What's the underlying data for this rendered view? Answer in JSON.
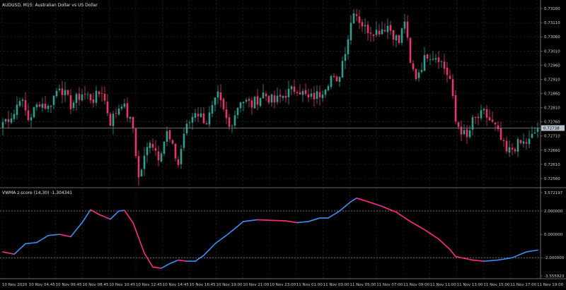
{
  "main_panel": {
    "title": "AUDUSD, M15:  Australian Dollar vs US Dollar",
    "price_ticks": [
      "0.73160",
      "0.73110",
      "0.73060",
      "0.73010",
      "0.72960",
      "0.72910",
      "0.72860",
      "0.72810",
      "0.72760",
      "0.72710",
      "0.72660",
      "0.72610",
      "0.72560"
    ],
    "current_price": "0.72738",
    "colors": {
      "bull": "#2e9e8e",
      "bear": "#e8356a",
      "grid": "#233040",
      "current_line": "#8a8a8a",
      "pricebox": "#b7c2cc"
    }
  },
  "indicator_panel": {
    "title": "VWMA z-score (14,30) -1.304341",
    "ticks": [
      "3.572197",
      "2.000000",
      "0.000000",
      "-2.000000",
      "-3.555923"
    ],
    "levels": [
      2.0,
      -2.0
    ],
    "colors": {
      "up": "#3d8df0",
      "down": "#ff2a8a",
      "level": "#9a9a9a"
    }
  },
  "time_axis": {
    "labels": [
      "10 Nov 2020",
      "10 Nov 04:45",
      "10 Nov 06:45",
      "10 Nov 08:45",
      "10 Nov 10:45",
      "10 Nov 12:45",
      "10 Nov 14:45",
      "10 Nov 16:45",
      "10 Nov 19:00",
      "10 Nov 21:00",
      "10 Nov 23:00",
      "11 Nov 01:00",
      "11 Nov 03:00",
      "11 Nov 05:00",
      "11 Nov 07:00",
      "11 Nov 09:00",
      "11 Nov 11:00",
      "11 Nov 13:00",
      "11 Nov 15:00",
      "11 Nov 17:00",
      "11 Nov 19:00"
    ]
  },
  "chart_data": [
    {
      "type": "candlestick",
      "title": "AUDUSD, M15:  Australian Dollar vs US Dollar",
      "ylim": [
        0.7253,
        0.7319
      ],
      "anchors_close": [
        [
          0,
          0.7276
        ],
        [
          4,
          0.7279
        ],
        [
          6,
          0.7285
        ],
        [
          9,
          0.7277
        ],
        [
          13,
          0.7283
        ],
        [
          16,
          0.7281
        ],
        [
          20,
          0.7289
        ],
        [
          24,
          0.7282
        ],
        [
          28,
          0.7286
        ],
        [
          32,
          0.7284
        ],
        [
          35,
          0.7287
        ],
        [
          38,
          0.7276
        ],
        [
          42,
          0.7283
        ],
        [
          46,
          0.7274
        ],
        [
          48,
          0.7256
        ],
        [
          52,
          0.727
        ],
        [
          55,
          0.7264
        ],
        [
          58,
          0.7272
        ],
        [
          62,
          0.7261
        ],
        [
          64,
          0.7272
        ],
        [
          68,
          0.728
        ],
        [
          72,
          0.7276
        ],
        [
          76,
          0.7285
        ],
        [
          80,
          0.7274
        ],
        [
          84,
          0.7284
        ],
        [
          88,
          0.7282
        ],
        [
          92,
          0.7286
        ],
        [
          96,
          0.7283
        ],
        [
          100,
          0.7286
        ],
        [
          104,
          0.7288
        ],
        [
          108,
          0.7284
        ],
        [
          112,
          0.7286
        ],
        [
          116,
          0.7292
        ],
        [
          118,
          0.7289
        ],
        [
          122,
          0.7306
        ],
        [
          124,
          0.7316
        ],
        [
          126,
          0.7312
        ],
        [
          128,
          0.7309
        ],
        [
          132,
          0.7308
        ],
        [
          136,
          0.731
        ],
        [
          140,
          0.7304
        ],
        [
          142,
          0.7312
        ],
        [
          144,
          0.7296
        ],
        [
          146,
          0.7292
        ],
        [
          150,
          0.73
        ],
        [
          154,
          0.7299
        ],
        [
          158,
          0.7291
        ],
        [
          160,
          0.7276
        ],
        [
          164,
          0.727
        ],
        [
          166,
          0.7276
        ],
        [
          170,
          0.7279
        ],
        [
          174,
          0.7274
        ],
        [
          178,
          0.7265
        ],
        [
          182,
          0.7268
        ],
        [
          186,
          0.7269
        ],
        [
          189,
          0.72738
        ]
      ],
      "current": 0.72738
    },
    {
      "type": "line",
      "title": "VWMA z-score (14,30) -1.304341",
      "ylim": [
        -3.555923,
        3.572197
      ],
      "levels": [
        2.0,
        -2.0
      ],
      "series": [
        {
          "values": [
            [
              0,
              -1.5
            ],
            [
              4,
              -1.7
            ],
            [
              8,
              -0.8
            ],
            [
              12,
              -0.7
            ],
            [
              16,
              -0.1
            ],
            [
              20,
              0.0
            ],
            [
              24,
              -0.2
            ],
            [
              28,
              1.0
            ],
            [
              31,
              2.1
            ],
            [
              34,
              1.7
            ],
            [
              38,
              1.3
            ],
            [
              41,
              2.0
            ],
            [
              43,
              2.05
            ],
            [
              46,
              1.0
            ],
            [
              50,
              -1.6
            ],
            [
              53,
              -2.8
            ],
            [
              56,
              -2.9
            ],
            [
              59,
              -2.5
            ],
            [
              62,
              -2.2
            ],
            [
              65,
              -2.3
            ],
            [
              68,
              -2.3
            ],
            [
              71,
              -1.8
            ],
            [
              75,
              -0.8
            ],
            [
              80,
              0.1
            ],
            [
              85,
              1.1
            ],
            [
              90,
              1.25
            ],
            [
              95,
              1.2
            ],
            [
              100,
              1.15
            ],
            [
              104,
              1.0
            ],
            [
              108,
              1.1
            ],
            [
              112,
              1.4
            ],
            [
              115,
              1.4
            ],
            [
              119,
              2.0
            ],
            [
              123,
              2.8
            ],
            [
              125,
              3.1
            ],
            [
              129,
              2.8
            ],
            [
              134,
              2.4
            ],
            [
              139,
              1.9
            ],
            [
              144,
              1.1
            ],
            [
              149,
              0.4
            ],
            [
              154,
              -0.4
            ],
            [
              158,
              -1.3
            ],
            [
              160,
              -1.9
            ],
            [
              162,
              -2.0
            ],
            [
              166,
              -2.2
            ],
            [
              170,
              -2.3
            ],
            [
              175,
              -2.2
            ],
            [
              180,
              -2.0
            ],
            [
              185,
              -1.5
            ],
            [
              189,
              -1.35
            ]
          ]
        }
      ]
    }
  ]
}
